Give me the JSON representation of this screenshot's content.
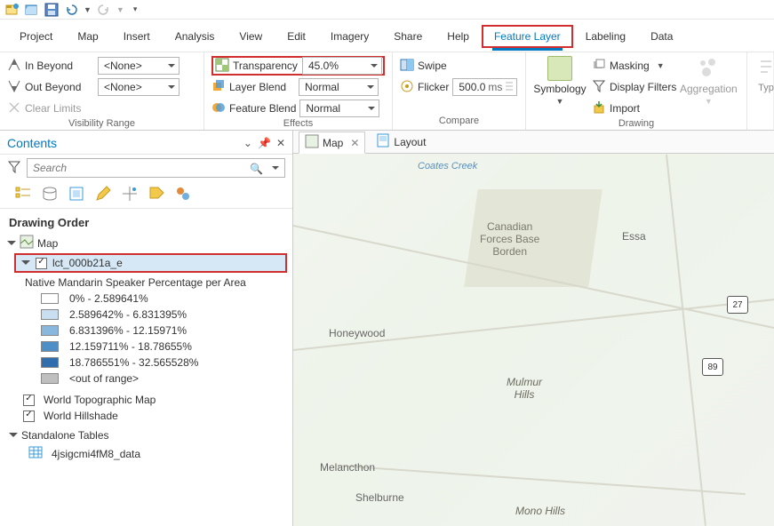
{
  "menu": {
    "project": "Project",
    "map": "Map",
    "insert": "Insert",
    "analysis": "Analysis",
    "view": "View",
    "edit": "Edit",
    "imagery": "Imagery",
    "share": "Share",
    "help": "Help",
    "feature_layer": "Feature Layer",
    "labeling": "Labeling",
    "data": "Data"
  },
  "ribbon": {
    "visibility": {
      "in_beyond": "In Beyond",
      "out_beyond": "Out Beyond",
      "clear_limits": "Clear Limits",
      "in_val": "<None>",
      "out_val": "<None>",
      "group": "Visibility Range"
    },
    "effects": {
      "transparency": "Transparency",
      "transparency_val": "45.0%",
      "layer_blend": "Layer Blend",
      "layer_blend_val": "Normal",
      "feature_blend": "Feature Blend",
      "feature_blend_val": "Normal",
      "group": "Effects"
    },
    "compare": {
      "swipe": "Swipe",
      "flicker": "Flicker",
      "flicker_val": "500.0",
      "flicker_unit": "ms",
      "group": "Compare"
    },
    "drawing": {
      "symbology": "Symbology",
      "masking": "Masking",
      "display_filters": "Display Filters",
      "import": "Import",
      "aggregation": "Aggregation",
      "group": "Drawing"
    },
    "typ": "Typ"
  },
  "contents": {
    "title": "Contents",
    "search_placeholder": "Search",
    "drawing_order": "Drawing Order",
    "map": "Map",
    "layer_name": "lct_000b21a_e",
    "symb_title": "Native Mandarin Speaker Percentage per Area",
    "classes": [
      {
        "label": "0% - 2.589641%",
        "color": "#ffffff"
      },
      {
        "label": "2.589642% - 6.831395%",
        "color": "#c9dff1"
      },
      {
        "label": "6.831396% - 12.15971%",
        "color": "#89b7dd"
      },
      {
        "label": "12.159711% - 18.78655%",
        "color": "#4f8fc7"
      },
      {
        "label": "18.786551% - 32.565528%",
        "color": "#2f6daf"
      }
    ],
    "out_of_range": "<out of range>",
    "basemap1": "World Topographic Map",
    "basemap2": "World Hillshade",
    "standalone": "Standalone Tables",
    "table1": "4jsigcmi4fM8_data"
  },
  "maptabs": {
    "map": "Map",
    "layout": "Layout"
  },
  "map": {
    "labels": {
      "cfb": "Canadian\nForces Base\nBorden",
      "essa": "Essa",
      "honeywood": "Honeywood",
      "mulmur": "Mulmur\nHills",
      "melancthon": "Melancthon",
      "shelburne": "Shelburne",
      "mono": "Mono Hills",
      "creek": "Coates Creek"
    },
    "shields": {
      "r27": "27",
      "r89": "89"
    }
  }
}
